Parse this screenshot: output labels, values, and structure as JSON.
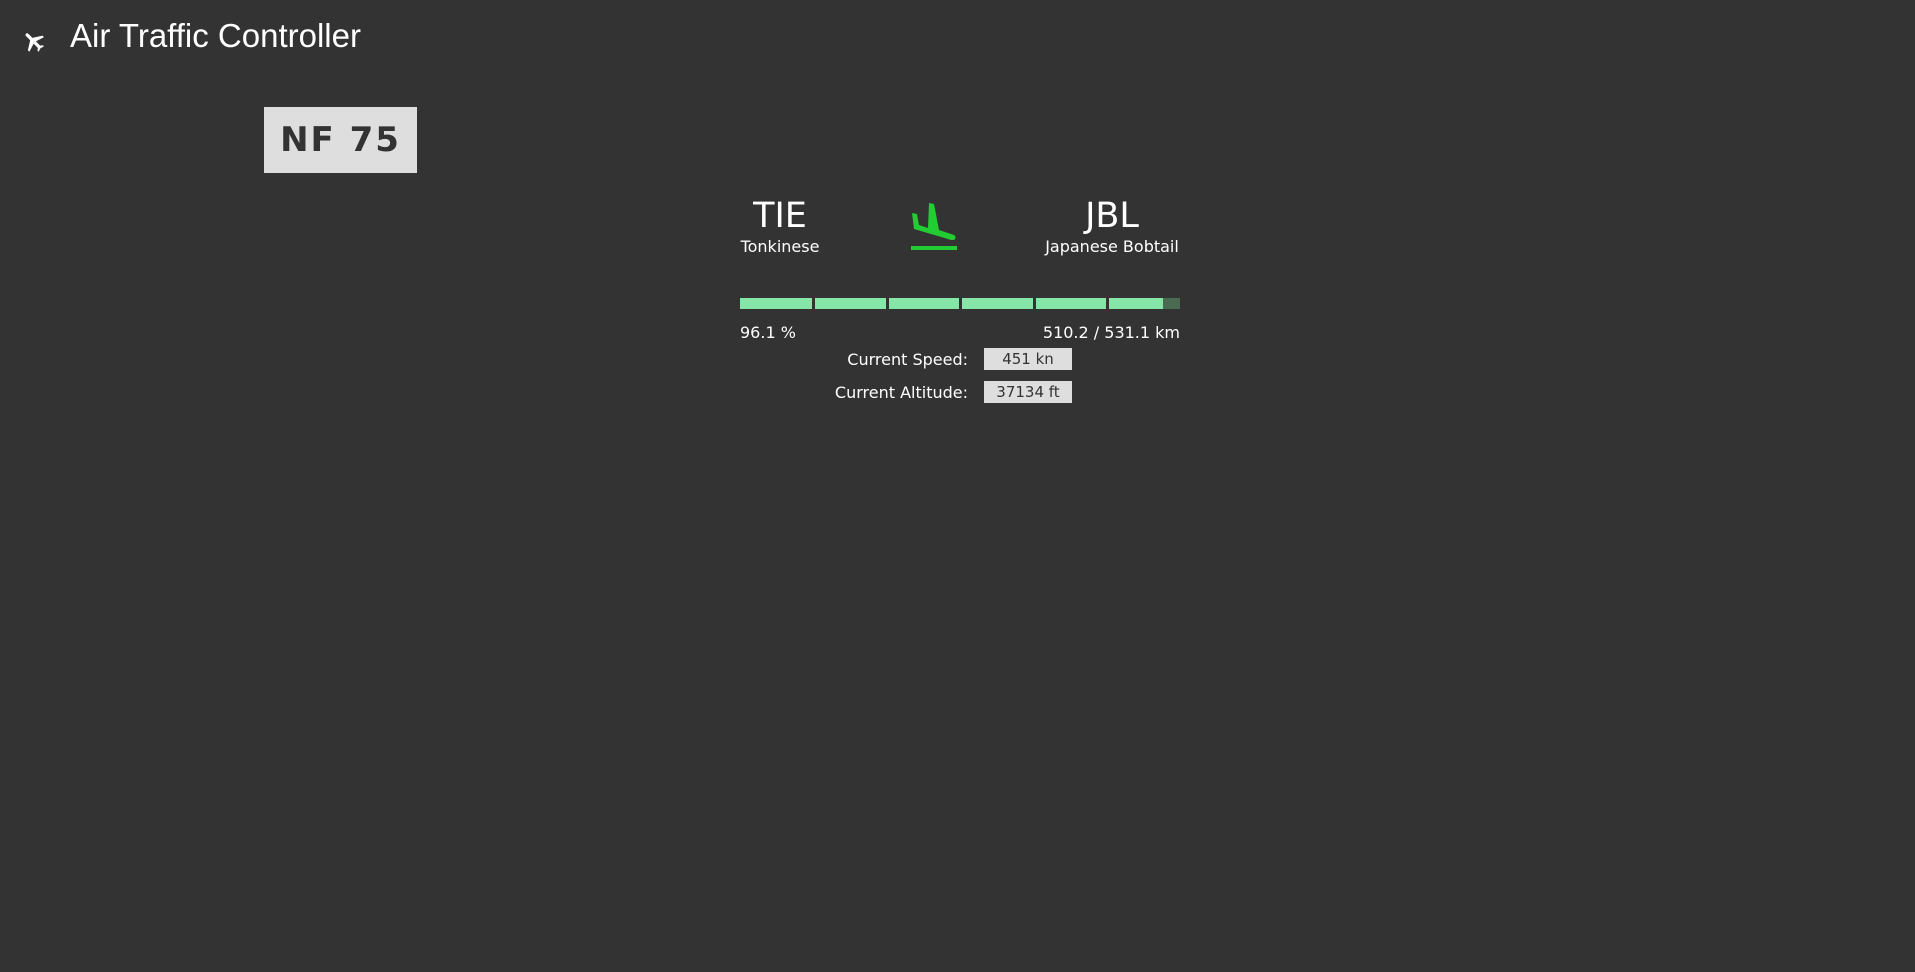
{
  "app": {
    "title": "Air Traffic Controller",
    "icon": "airplane-icon"
  },
  "flight": {
    "callsign": "NF 75",
    "status_icon": "flight-land-icon",
    "status_color": "#22cc33",
    "origin": {
      "code": "TIE",
      "name": "Tonkinese"
    },
    "destination": {
      "code": "JBL",
      "name": "Japanese Bobtail"
    },
    "progress": {
      "fraction": 0.961,
      "percent_text": "96.1 %",
      "distance_text": "510.2 / 531.1 km",
      "fill_color": "#86e6a7",
      "track_color": "#4a6b52"
    },
    "speed": {
      "label": "Current Speed:",
      "value": "451 kn"
    },
    "altitude": {
      "label": "Current Altitude:",
      "value": "37134 ft"
    }
  },
  "colors": {
    "background": "#333333",
    "value_box": "#dedede"
  }
}
